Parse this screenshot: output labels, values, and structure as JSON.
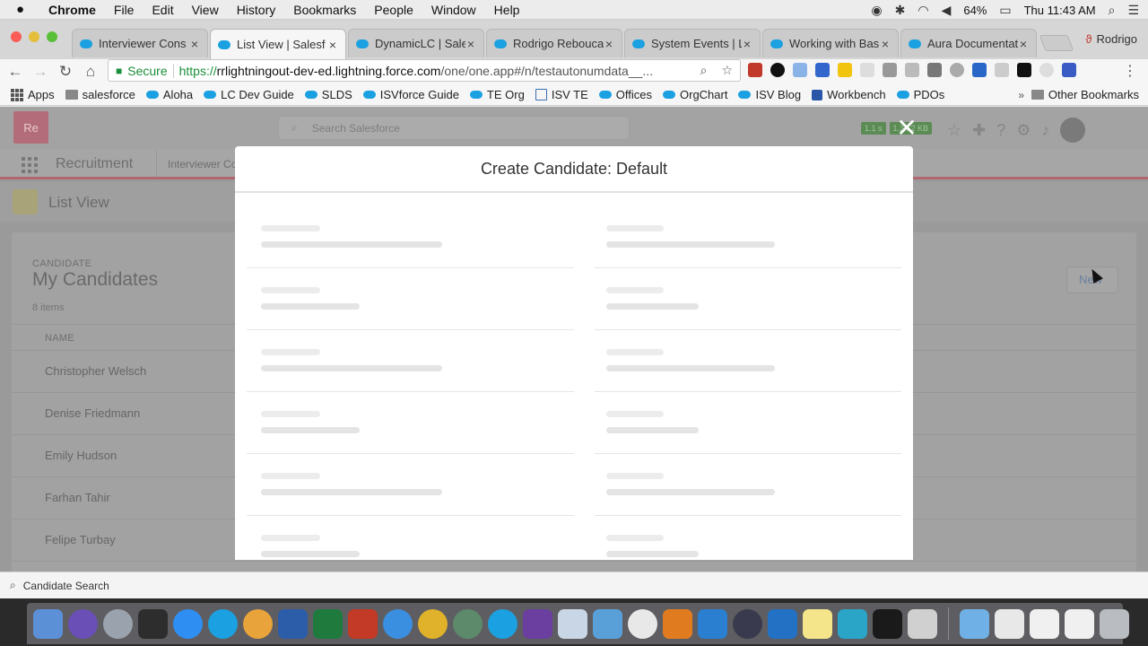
{
  "menubar": {
    "app": "Chrome",
    "items": [
      "File",
      "Edit",
      "View",
      "History",
      "Bookmarks",
      "People",
      "Window",
      "Help"
    ],
    "battery": "64%",
    "clock": "Thu 11:43 AM"
  },
  "tabs": [
    {
      "title": "Interviewer Cons",
      "active": false
    },
    {
      "title": "List View | Salesf",
      "active": true
    },
    {
      "title": "DynamicLC | Sale",
      "active": false
    },
    {
      "title": "Rodrigo Rebouca",
      "active": false
    },
    {
      "title": "System Events | L",
      "active": false
    },
    {
      "title": "Working with Bas",
      "active": false
    },
    {
      "title": "Aura Documentat",
      "active": false
    }
  ],
  "profile_name": "Rodrigo",
  "omnibox": {
    "secure_label": "Secure",
    "url_scheme": "https://",
    "url_host": "rrlightningout-dev-ed.lightning.force.com",
    "url_path": "/one/one.app#/n/testautonumdata__..."
  },
  "bookmarks": {
    "items": [
      "Apps",
      "salesforce",
      "Aloha",
      "LC Dev Guide",
      "SLDS",
      "ISVforce Guide",
      "TE Org",
      "ISV TE",
      "Offices",
      "OrgChart",
      "ISV Blog",
      "Workbench",
      "PDOs"
    ],
    "chevron": "»",
    "other": "Other Bookmarks"
  },
  "salesforce": {
    "logo_text": "Re",
    "search_placeholder": "Search Salesforce",
    "badges": [
      "1.1 s",
      "1.3 52 KB"
    ],
    "app_name": "Recruitment",
    "nav_item": "Interviewer Co",
    "list_view_title": "List View",
    "object_label": "CANDIDATE",
    "list_name": "My Candidates",
    "item_count": "8 items",
    "new_button": "New",
    "column_name": "NAME",
    "rows": [
      "Christopher Welsch",
      "Denise Friedmann",
      "Emily Hudson",
      "Farhan Tahir",
      "Felipe Turbay"
    ]
  },
  "modal": {
    "title": "Create Candidate: Default",
    "close_glyph": "✕"
  },
  "utility_bar": {
    "label": "Candidate Search"
  },
  "colors": {
    "salesforce_blue": "#1ba1e2",
    "secure_green": "#1a8f3a",
    "nav_accent": "#b1676f"
  }
}
